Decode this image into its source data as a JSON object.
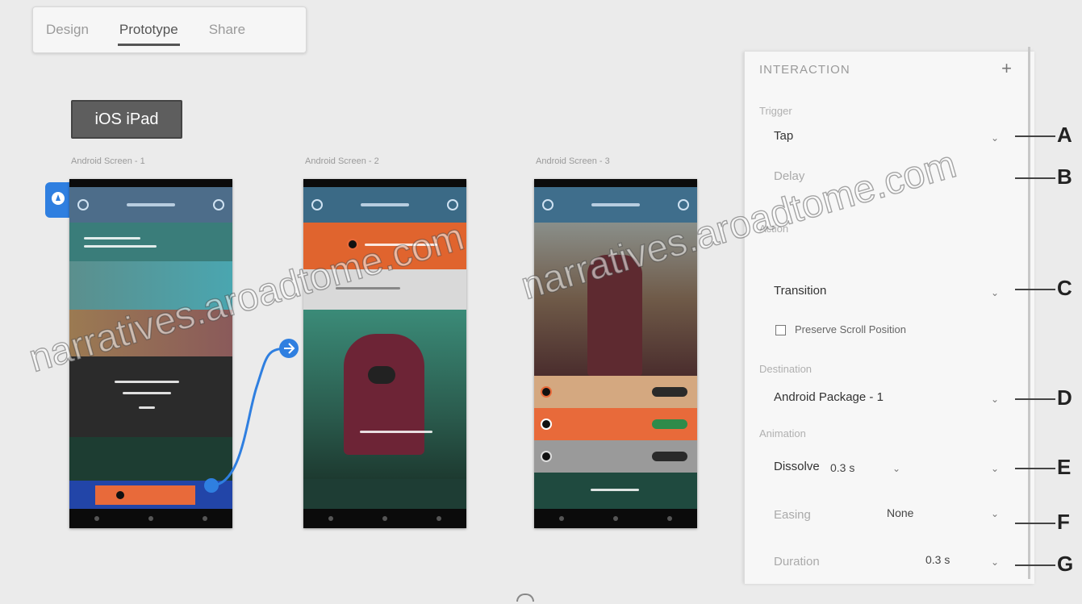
{
  "tabs": [
    {
      "label": "Design"
    },
    {
      "label": "Prototype"
    },
    {
      "label": "Share"
    }
  ],
  "active_tab": "Prototype",
  "device_label": "iOS iPad",
  "artboards": [
    {
      "label": "Android Screen - 1"
    },
    {
      "label": "Android Screen - 2"
    },
    {
      "label": "Android Screen - 3"
    }
  ],
  "panel": {
    "title": "INTERACTION",
    "add_label": "+",
    "trigger_label": "Trigger",
    "trigger_value": "Tap",
    "delay_label": "Delay",
    "action_label": "Action",
    "action_value": "Transition",
    "preserve_label": "Preserve Scroll Position",
    "destination_label": "Destination",
    "destination_value": "Android Package - 1",
    "animation_label": "Animation",
    "animation_value": "Dissolve",
    "animation_duration": "0.3 s",
    "easing_label": "Easing",
    "easing_value": "None",
    "duration_label": "Duration",
    "duration_value": "0.3 s"
  },
  "callouts": [
    "A",
    "B",
    "C",
    "D",
    "E",
    "F",
    "G"
  ],
  "watermark": "narratives.aroadtome.com",
  "colors": {
    "accent": "#2f7fe0",
    "orange": "#e86a3a",
    "teal": "#2e6e7a"
  }
}
